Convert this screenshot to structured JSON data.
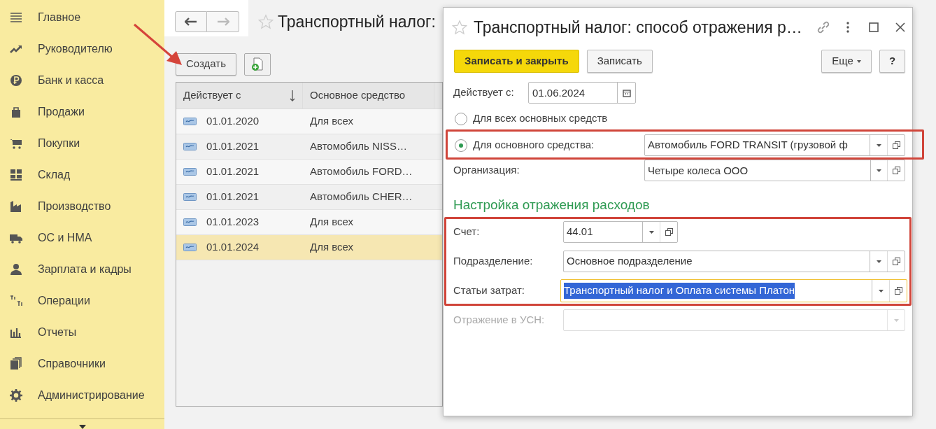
{
  "sidebar": {
    "items": [
      {
        "label": "Главное"
      },
      {
        "label": "Руководителю"
      },
      {
        "label": "Банк и касса"
      },
      {
        "label": "Продажи"
      },
      {
        "label": "Покупки"
      },
      {
        "label": "Склад"
      },
      {
        "label": "Производство"
      },
      {
        "label": "ОС и НМА"
      },
      {
        "label": "Зарплата и кадры"
      },
      {
        "label": "Операции"
      },
      {
        "label": "Отчеты"
      },
      {
        "label": "Справочники"
      },
      {
        "label": "Администрирование"
      }
    ]
  },
  "list": {
    "title": "Транспортный налог:",
    "create_button": "Создать",
    "table": {
      "columns": [
        {
          "label": "Действует с",
          "sorted": true
        },
        {
          "label": "Основное средство",
          "sorted": false
        }
      ],
      "rows": [
        {
          "date": "01.01.2020",
          "asset": "Для всех",
          "selected": false
        },
        {
          "date": "01.01.2021",
          "asset": "Автомобиль NISS…",
          "selected": false
        },
        {
          "date": "01.01.2021",
          "asset": "Автомобиль FORD…",
          "selected": false
        },
        {
          "date": "01.01.2021",
          "asset": "Автомобиль CHER…",
          "selected": false
        },
        {
          "date": "01.01.2023",
          "asset": "Для всех",
          "selected": false
        },
        {
          "date": "01.01.2024",
          "asset": "Для всех",
          "selected": true
        }
      ]
    }
  },
  "dialog": {
    "title": "Транспортный налог: способ отражения р…",
    "buttons": [
      {
        "label": "Записать и закрыть",
        "kind": "primary"
      },
      {
        "label": "Записать",
        "kind": "plain"
      }
    ],
    "more_button": "Еще",
    "help_button": "?",
    "effective_date": {
      "label": "Действует с:",
      "value": "01.06.2024"
    },
    "radios": [
      {
        "label": "Для всех основных средств",
        "selected": false
      },
      {
        "label": "Для основного средства:",
        "selected": true,
        "value": "Автомобиль FORD TRANSIT (грузовой ф"
      }
    ],
    "organization": {
      "label": "Организация:",
      "value": "Четыре колеса ООО"
    },
    "section_title": "Настройка отражения расходов",
    "fields": [
      {
        "label": "Счет:",
        "value": "44.01",
        "focused": false,
        "disabled": false
      },
      {
        "label": "Подразделение:",
        "value": "Основное подразделение",
        "focused": false,
        "disabled": false
      },
      {
        "label": "Статьи затрат:",
        "value": "Транспортный налог  и Оплата системы Платон",
        "focused": true,
        "disabled": false
      },
      {
        "label": "Отражение в УСН:",
        "focused": false,
        "disabled": true
      }
    ]
  }
}
